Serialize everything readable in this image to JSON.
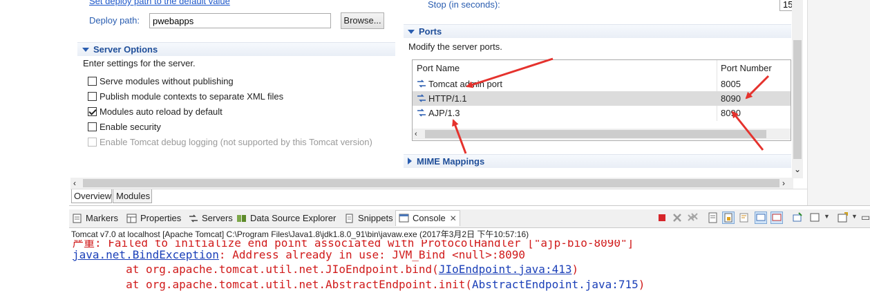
{
  "deploy": {
    "default_link": "Set deploy path to the default value",
    "path_label": "Deploy path:",
    "path_value": "pwebapps",
    "browse_label": "Browse..."
  },
  "timeouts": {
    "stop_label": "Stop (in seconds):",
    "stop_value": "15"
  },
  "server_options": {
    "title": "Server Options",
    "description": "Enter settings for the server.",
    "options": [
      {
        "label": "Serve modules without publishing",
        "checked": false,
        "enabled": true
      },
      {
        "label": "Publish module contexts to separate XML files",
        "checked": false,
        "enabled": true
      },
      {
        "label": "Modules auto reload by default",
        "checked": true,
        "enabled": true
      },
      {
        "label": "Enable security",
        "checked": false,
        "enabled": true
      },
      {
        "label": "Enable Tomcat debug logging (not supported by this Tomcat version)",
        "checked": false,
        "enabled": false
      }
    ]
  },
  "ports": {
    "title": "Ports",
    "description": "Modify the server ports.",
    "col_name": "Port Name",
    "col_number": "Port Number",
    "rows": [
      {
        "name": "Tomcat admin port",
        "number": "8005"
      },
      {
        "name": "HTTP/1.1",
        "number": "8090"
      },
      {
        "name": "AJP/1.3",
        "number": "8090"
      }
    ]
  },
  "mime": {
    "title": "MIME Mappings"
  },
  "editor_tabs": [
    "Overview",
    "Modules"
  ],
  "views": [
    "Markers",
    "Properties",
    "Servers",
    "Data Source Explorer",
    "Snippets",
    "Console"
  ],
  "console": {
    "header": "Tomcat v7.0 at localhost [Apache Tomcat] C:\\Program Files\\Java1.8\\jdk1.8.0_91\\bin\\javaw.exe (2017年3月2日 下午10:57:16)",
    "line0": "严重: Failed to initialize end point associated with ProtocolHandler [\"ajp-bio-8090\"]",
    "exception_class": "java.net.BindException",
    "exception_msg": ": Address already in use: JVM_Bind <null>:8090",
    "at1_prefix": "        at org.apache.tomcat.util.net.JIoEndpoint.bind(",
    "at1_link": "JIoEndpoint.java:413",
    "at1_suffix": ")",
    "at2_prefix": "        at org.apache.tomcat.util.net.AbstractEndpoint.init(",
    "at2_link": "AbstractEndpoint.java:715",
    "at2_suffix": ")"
  },
  "colors": {
    "section_title": "#1f4e99",
    "annotation_arrow": "#e5322d",
    "console_error": "#d01a1a",
    "console_link": "#1a3fb8"
  }
}
